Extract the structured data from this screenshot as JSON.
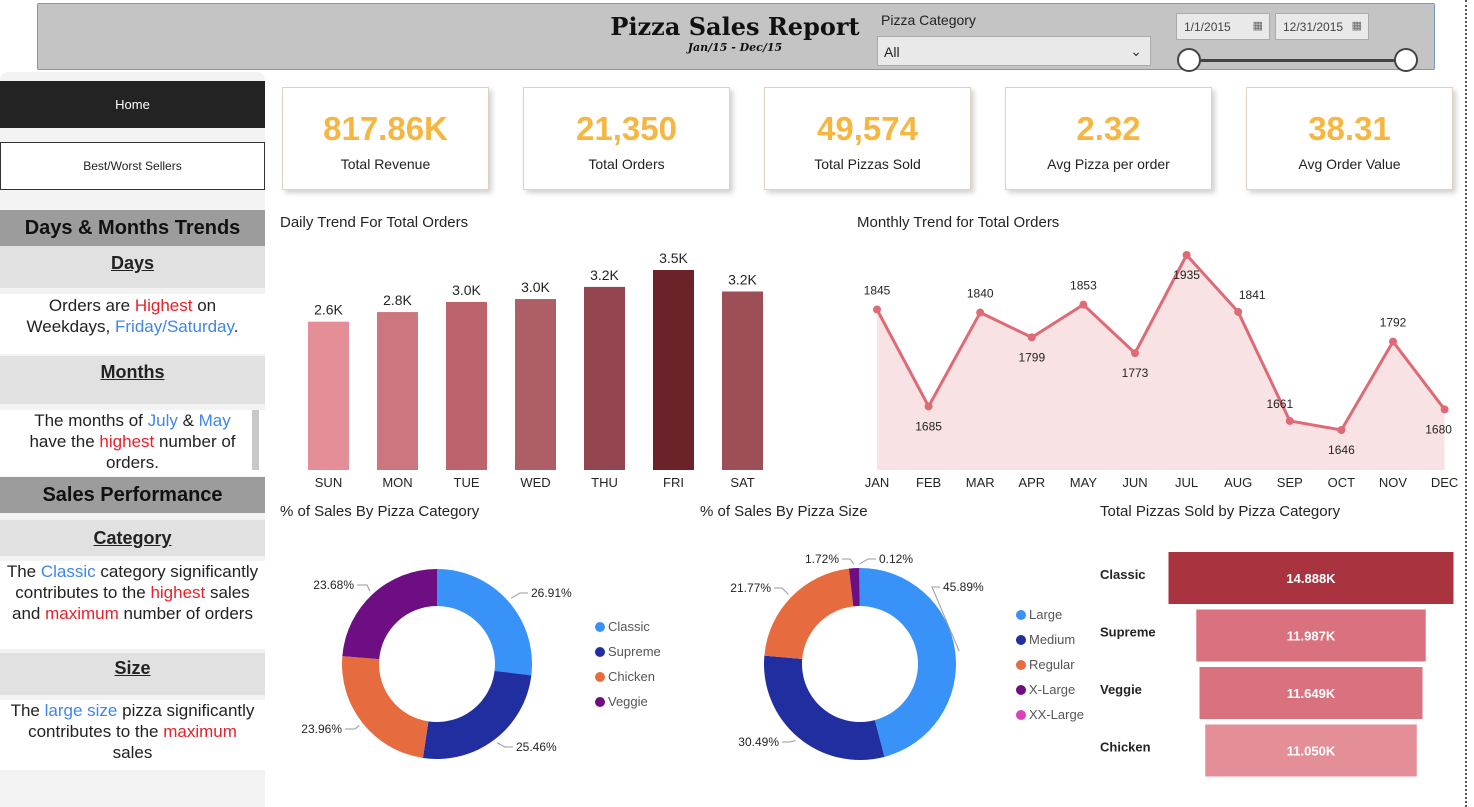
{
  "header": {
    "title": "Pizza Sales Report",
    "subtitle": "Jan/15 - Dec/15",
    "category_label": "Pizza Category",
    "category_value": "All",
    "date_start": "1/1/2015",
    "date_end": "12/31/2015"
  },
  "nav": {
    "home": "Home",
    "best_worst": "Best/Worst Sellers"
  },
  "sidebar": {
    "section1": "Days & Months Trends",
    "days_heading": "Days",
    "days_note": {
      "p1": "Orders are ",
      "hl1": "Highest",
      "p2": " on Weekdays, ",
      "hl2": "Friday/Saturday",
      "p3": "."
    },
    "months_heading": "Months",
    "months_note": {
      "p1": "The months of ",
      "hl1": "July",
      "p2": " & ",
      "hl2": "May",
      "p3": " have the ",
      "hl3": "highest",
      "p4": " number of orders."
    },
    "section2": "Sales Performance",
    "category_heading": "Category",
    "category_note": {
      "p1": "The ",
      "hl1": "Classic",
      "p2": " category significantly contributes to the ",
      "hl2": "highest",
      "p3": " sales and ",
      "hl3": "maximum",
      "p4": " number of orders"
    },
    "size_heading": "Size",
    "size_note": {
      "p1": "The ",
      "hl1": "large size",
      "p2": " pizza significantly contributes to the ",
      "hl2": "maximum",
      "p3": " sales"
    }
  },
  "kpis": [
    {
      "value": "817.86K",
      "label": "Total Revenue"
    },
    {
      "value": "21,350",
      "label": "Total Orders"
    },
    {
      "value": "49,574",
      "label": "Total Pizzas Sold"
    },
    {
      "value": "2.32",
      "label": "Avg Pizza per order"
    },
    {
      "value": "38.31",
      "label": "Avg Order Value"
    }
  ],
  "colors": {
    "accent": "#f5b742",
    "header_bg": "#c4c4c4",
    "area_line": "#de6a75",
    "area_fill": "#f8e2e4"
  },
  "chart_data": [
    {
      "type": "bar",
      "title": "Daily Trend For Total Orders",
      "categories": [
        "SUN",
        "MON",
        "TUE",
        "WED",
        "THU",
        "FRI",
        "SAT"
      ],
      "values": [
        2624,
        2794,
        2973,
        3024,
        3239,
        3538,
        3158
      ],
      "data_labels": [
        "2.6K",
        "2.8K",
        "3.0K",
        "3.0K",
        "3.2K",
        "3.5K",
        "3.2K"
      ],
      "colors": [
        "#e48e97",
        "#cc7780",
        "#bc636d",
        "#ad5e66",
        "#934650",
        "#6b2229",
        "#9c4f56"
      ],
      "ylim": [
        0,
        3538
      ]
    },
    {
      "type": "area",
      "title": "Monthly Trend for Total Orders",
      "categories": [
        "JAN",
        "FEB",
        "MAR",
        "APR",
        "MAY",
        "JUN",
        "JUL",
        "AUG",
        "SEP",
        "OCT",
        "NOV",
        "DEC"
      ],
      "values": [
        1845,
        1685,
        1840,
        1799,
        1853,
        1773,
        1935,
        1841,
        1661,
        1646,
        1792,
        1680
      ],
      "ylim": [
        1580,
        1935
      ]
    },
    {
      "type": "pie",
      "title": "% of Sales By Pizza Category",
      "labels": [
        "Classic",
        "Supreme",
        "Chicken",
        "Veggie"
      ],
      "values": [
        26.91,
        25.46,
        23.96,
        23.68
      ],
      "value_labels": [
        "26.91%",
        "25.46%",
        "23.96%",
        "23.68%"
      ],
      "colors": [
        "#3892f8",
        "#212ea0",
        "#e66c40",
        "#6d0f82"
      ]
    },
    {
      "type": "pie",
      "title": "% of Sales By Pizza Size",
      "labels": [
        "Large",
        "Medium",
        "Regular",
        "X-Large",
        "XX-Large"
      ],
      "values": [
        45.89,
        30.49,
        21.77,
        1.72,
        0.12
      ],
      "value_labels": [
        "45.89%",
        "30.49%",
        "21.77%",
        "1.72%",
        "0.12%"
      ],
      "colors": [
        "#3892f8",
        "#212ea0",
        "#e66c40",
        "#6d0f82",
        "#dd3fb8"
      ]
    },
    {
      "type": "bar",
      "orientation": "horizontal-funnel",
      "title": "Total Pizzas Sold by Pizza Category",
      "categories": [
        "Classic",
        "Supreme",
        "Veggie",
        "Chicken"
      ],
      "values": [
        14888,
        11987,
        11649,
        11050
      ],
      "data_labels": [
        "14.888K",
        "11.987K",
        "11.649K",
        "11.050K"
      ],
      "colors": [
        "#a9343f",
        "#d9727e",
        "#d9727e",
        "#e48e97"
      ]
    }
  ]
}
